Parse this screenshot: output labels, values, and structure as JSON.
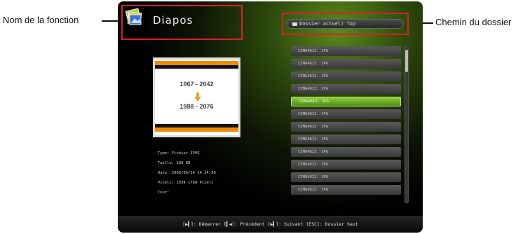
{
  "callouts": {
    "left_label": "Nom de la fonction",
    "right_label": "Chemin du dossier"
  },
  "header": {
    "function_title": "Diapos",
    "icon": "slideshow-photos-icon",
    "folder_path": "Dossier actuel) Top"
  },
  "preview": {
    "line1": "1967 - 2042",
    "line2": "1988 - 2076",
    "stripe_color": "#f08a00"
  },
  "file_info": {
    "type": "Type: Fichier JPEG",
    "size": "Taille: 180 KB",
    "date": "Date: 2008/04/24 14:24:00",
    "pixels": "Pixels: 1024 x768 Pixels",
    "rotation": "Tour:"
  },
  "file_list": {
    "items": [
      "CIMG4813. JPG",
      "CIMG4813. JPG",
      "CIMG4813. JPG",
      "CIMG4813. JPG",
      "CIMG4813. JPG",
      "CIMG4813. JPG",
      "CIMG4813. JPG",
      "CIMG4813. JPG",
      "CIMG4813. JPG",
      "CIMG4813. JPG",
      "CIMG4813. JPG",
      "CIMG4813. JPG"
    ],
    "selected_index": 4
  },
  "footer": {
    "help_text": "[▶▍]: Démarrer [▍◀]: Précédent [▶▍]: Suivant [ESC]: Dossier haut"
  },
  "colors": {
    "highlight_border": "#d9202a",
    "selected_item": "#7bbf2a",
    "accent_green": "#5c8a1a"
  }
}
